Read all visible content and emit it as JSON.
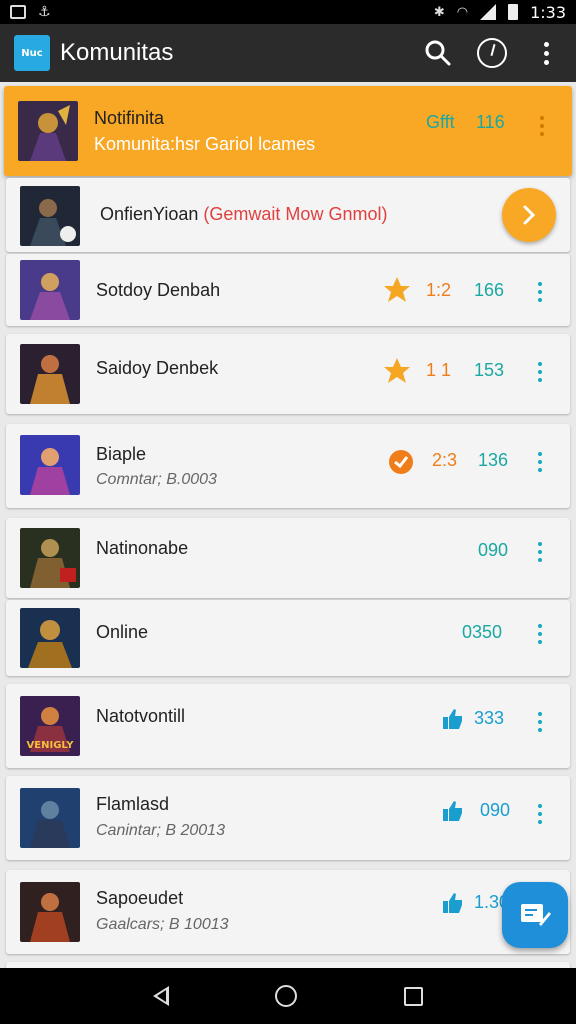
{
  "status_bar": {
    "time": "1:33"
  },
  "app": {
    "title": "Komunitas",
    "logo_text": "Nuc"
  },
  "featured": {
    "title": "Notifinita",
    "subtitle": "Komunita:hsr Gariol lcames",
    "tag": "Gfft",
    "count": "116"
  },
  "promo": {
    "title": "OnfienYioan",
    "tag": "(Gemwait Mow Gnmol)"
  },
  "items": [
    {
      "title": "Sotdoy Denbah",
      "rating": "1:2",
      "count": "166",
      "icon": "star-icon"
    },
    {
      "title": "Saidoy Denbek",
      "rating": "1 1",
      "count": "153",
      "icon": "star-icon"
    },
    {
      "title": "Biaple",
      "subtitle": "Comntar; B.0003",
      "rating": "2:3",
      "count": "136",
      "icon": "badge-icon"
    },
    {
      "title": "Natinonabe",
      "count": "090"
    },
    {
      "title": "Online",
      "count": "0350"
    },
    {
      "title": "Natotvontill",
      "count": "333",
      "icon": "thumbs-up-icon",
      "thumb_text": "VENIGLY"
    },
    {
      "title": "Flamlasd",
      "subtitle": "Canintar; B 20013",
      "count": "090",
      "icon": "thumbs-up-icon"
    },
    {
      "title": "Sapoeudet",
      "subtitle": "Gaalcars; B 10013",
      "count": "1.30",
      "icon": "thumbs-up-icon"
    }
  ],
  "colors": {
    "accent": "#f8a825",
    "teal": "#1aa8a0",
    "fab": "#1e8fd8",
    "appbar": "#2b2b2b"
  }
}
